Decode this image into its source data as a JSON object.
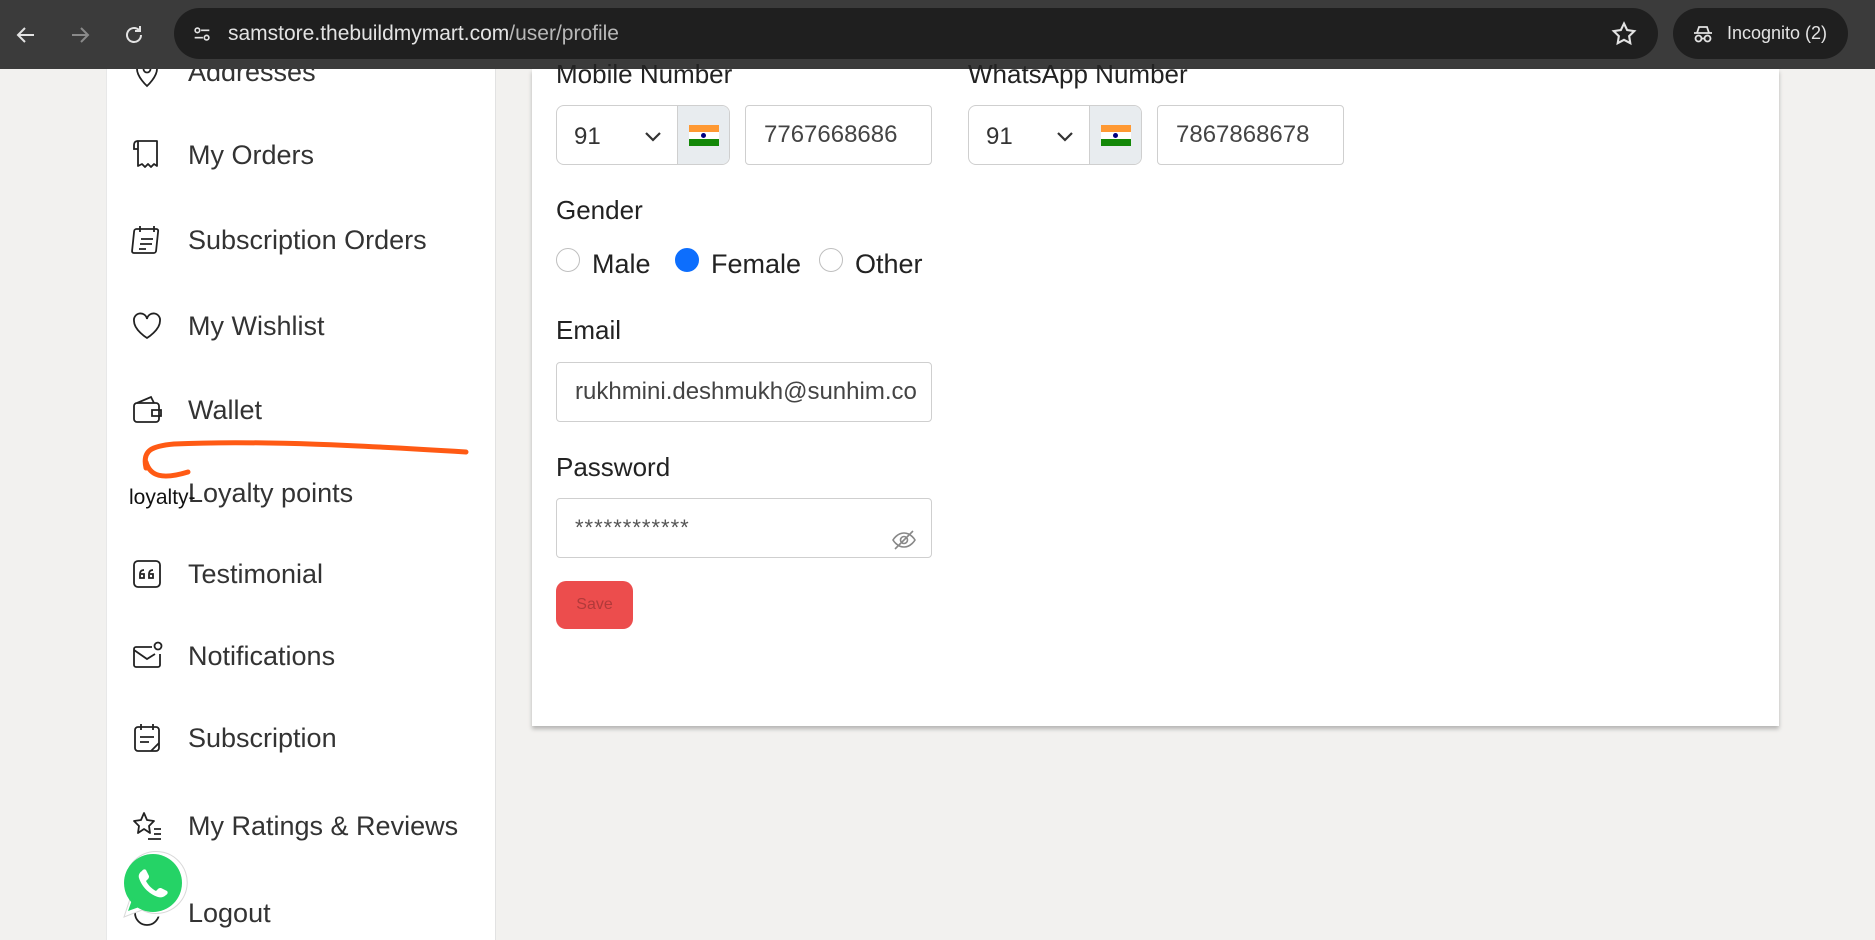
{
  "browser": {
    "url_host": "samstore.thebuildmymart.com",
    "url_path": "/user/profile",
    "incognito_label": "Incognito (2)"
  },
  "sidebar": {
    "items": [
      {
        "label": "Addresses",
        "icon": "location-pin-icon"
      },
      {
        "label": "My Orders",
        "icon": "receipt-icon"
      },
      {
        "label": "Subscription Orders",
        "icon": "calendar-list-icon"
      },
      {
        "label": "My Wishlist",
        "icon": "heart-icon"
      },
      {
        "label": "Wallet",
        "icon": "wallet-icon"
      },
      {
        "label": "Loyalty points",
        "icon": "loyalty-image-broken"
      },
      {
        "label": "Testimonial",
        "icon": "quote-icon"
      },
      {
        "label": "Notifications",
        "icon": "mail-notification-icon"
      },
      {
        "label": "Subscription",
        "icon": "calendar-note-icon"
      },
      {
        "label": "My Ratings & Reviews",
        "icon": "star-list-icon"
      },
      {
        "label": "Logout",
        "icon": "logout-icon"
      }
    ],
    "loyalty_alt_text": "loyalty-point"
  },
  "form": {
    "mobile": {
      "label": "Mobile Number",
      "country_code": "91",
      "number": "7767668686"
    },
    "whatsapp": {
      "label": "WhatsApp Number",
      "country_code": "91",
      "number": "7867868678"
    },
    "gender": {
      "label": "Gender",
      "options": [
        "Male",
        "Female",
        "Other"
      ],
      "selected": "Female"
    },
    "email": {
      "label": "Email",
      "value": "rukhmini.deshmukh@sunhim.co"
    },
    "password": {
      "label": "Password",
      "value": "************"
    },
    "save_label": "Save"
  },
  "colors": {
    "accent_blue": "#0d6efd",
    "save_red": "#ec4d4d",
    "annotation_orange": "#ff5a14",
    "whatsapp_green": "#25d366"
  }
}
